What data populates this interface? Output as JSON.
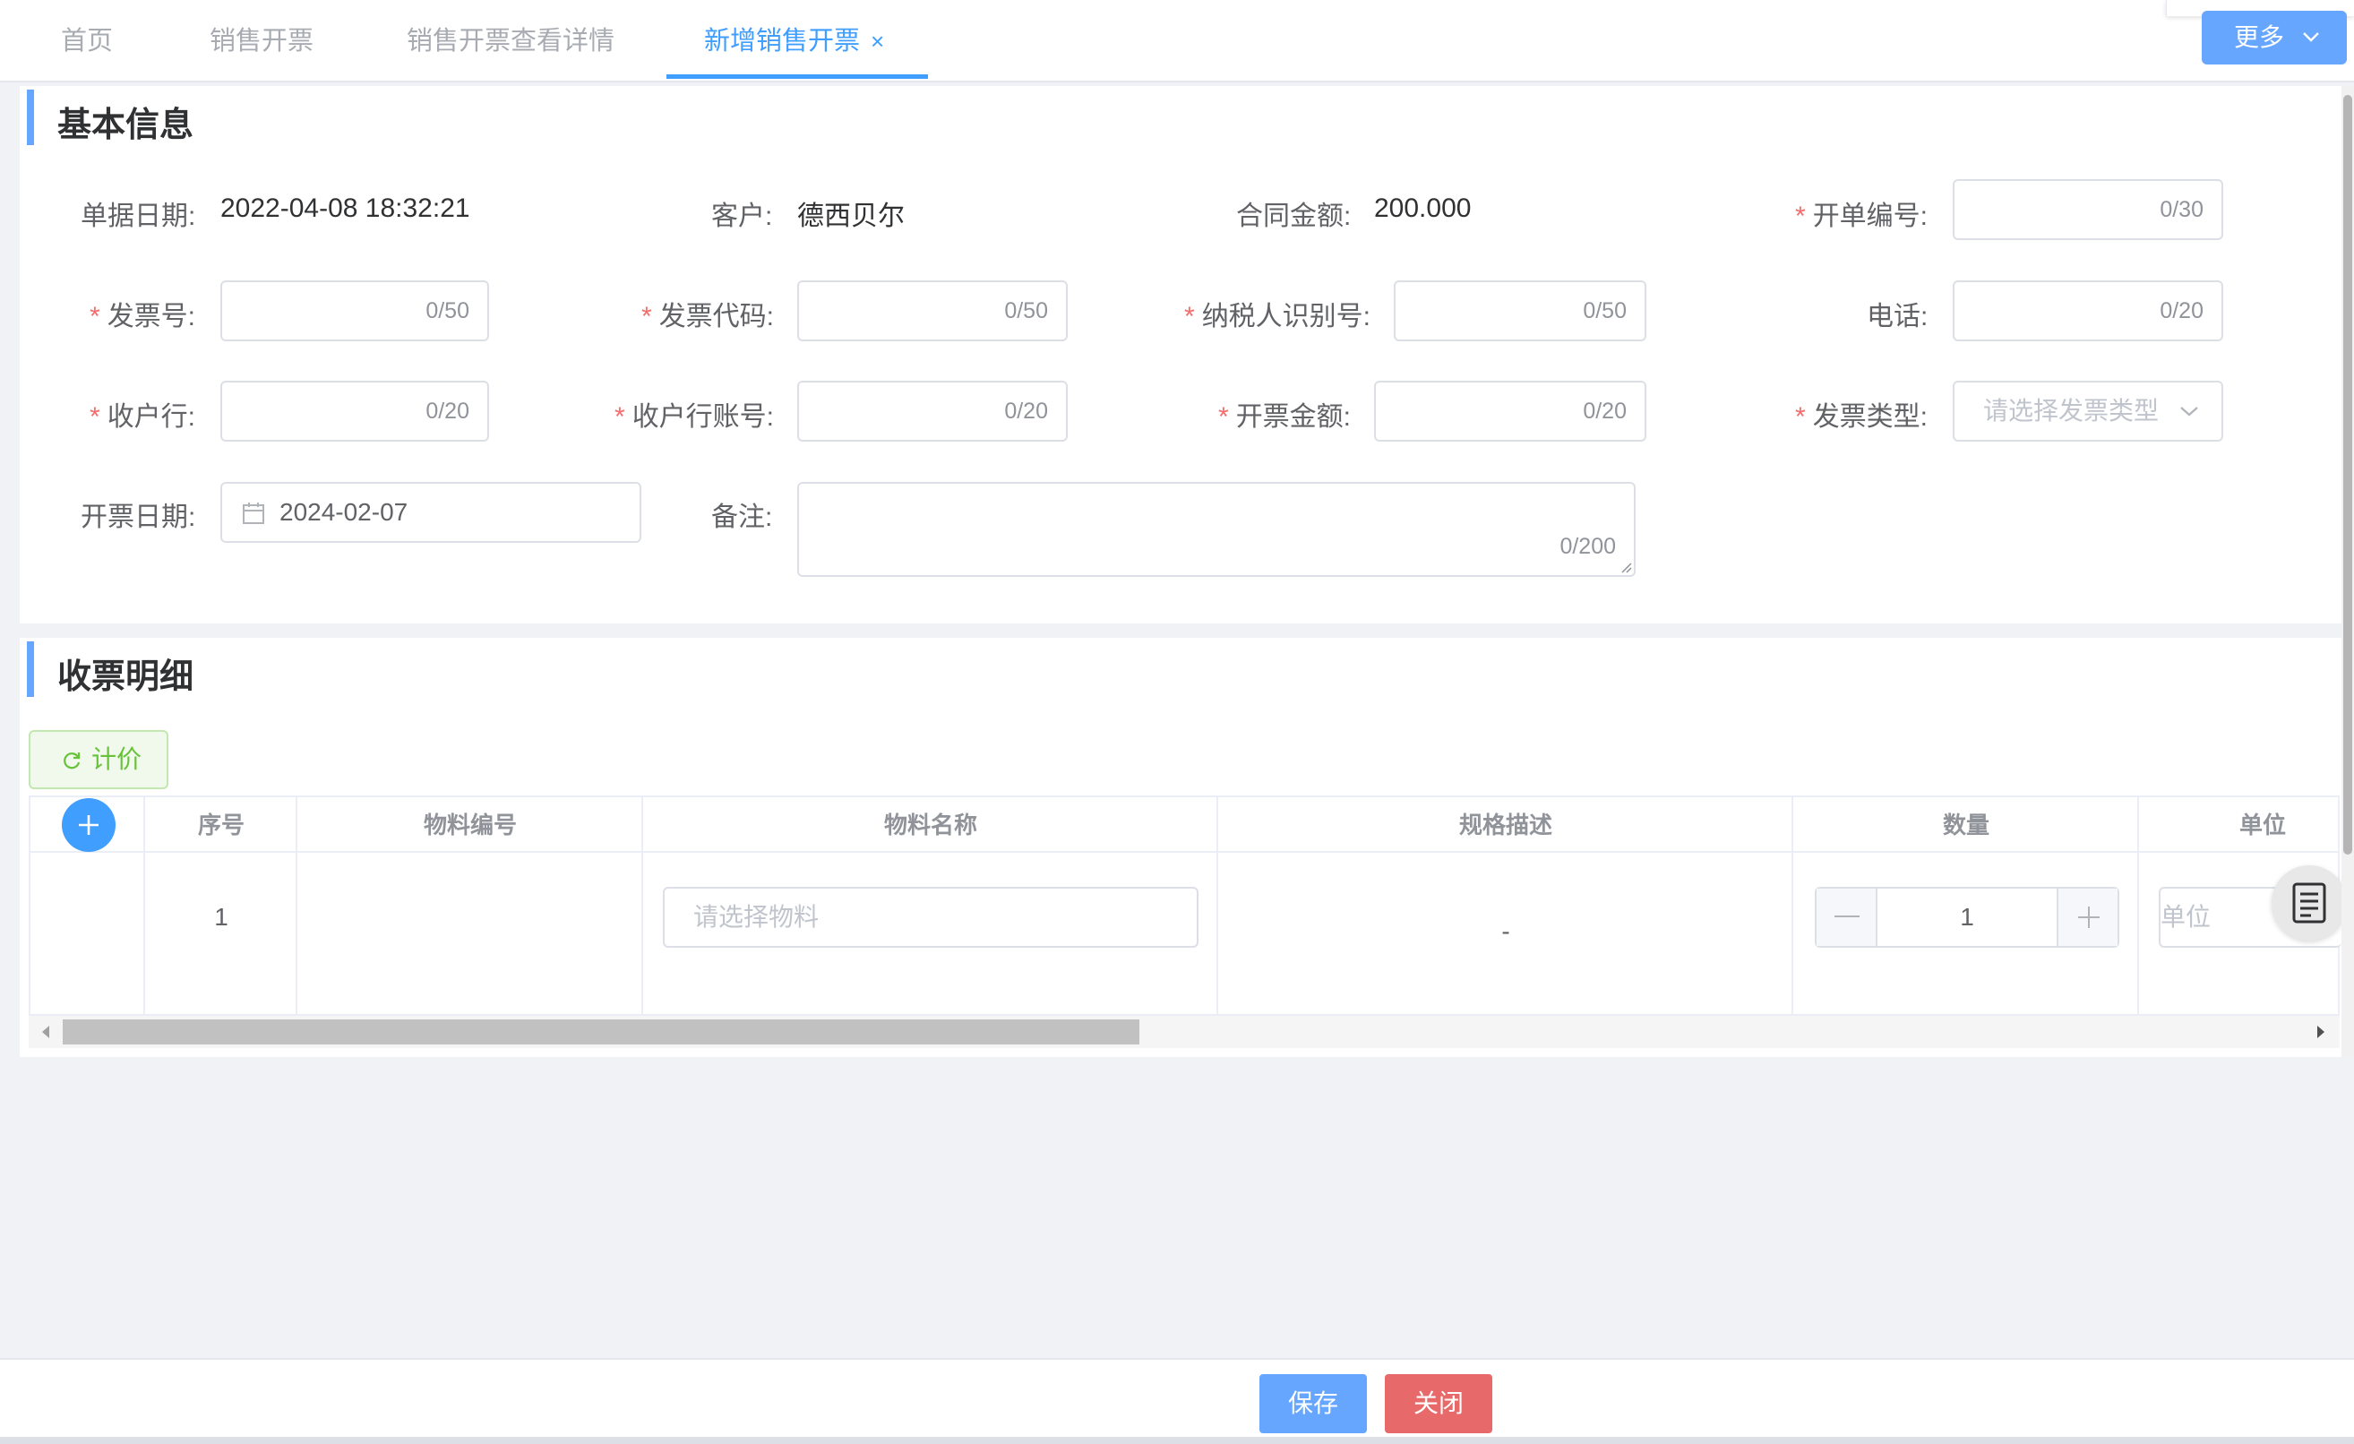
{
  "tabs": [
    {
      "label": "首页"
    },
    {
      "label": "销售开票"
    },
    {
      "label": "销售开票查看详情"
    },
    {
      "label": "新增销售开票"
    }
  ],
  "more_button": "更多",
  "basic": {
    "title": "基本信息",
    "doc_date_label": "单据日期:",
    "doc_date_value": "2022-04-08 18:32:21",
    "customer_label": "客户:",
    "customer_value": "德西贝尔",
    "contract_amount_label": "合同金额:",
    "contract_amount_value": "200.000",
    "bill_no_label": "开单编号:",
    "bill_no_count": "0/30",
    "invoice_no_label": "发票号:",
    "invoice_no_count": "0/50",
    "invoice_code_label": "发票代码:",
    "invoice_code_count": "0/50",
    "taxpayer_id_label": "纳税人识别号:",
    "taxpayer_id_count": "0/50",
    "phone_label": "电话:",
    "phone_count": "0/20",
    "bank_label": "收户行:",
    "bank_count": "0/20",
    "bank_account_label": "收户行账号:",
    "bank_account_count": "0/20",
    "invoice_amount_label": "开票金额:",
    "invoice_amount_count": "0/20",
    "invoice_type_label": "发票类型:",
    "invoice_type_placeholder": "请选择发票类型",
    "invoice_date_label": "开票日期:",
    "invoice_date_value": "2024-02-07",
    "remark_label": "备注:",
    "remark_count": "0/200",
    "required_mark": "*"
  },
  "detail": {
    "title": "收票明细",
    "calc_button": "计价",
    "columns": [
      "序号",
      "物料编号",
      "物料名称",
      "规格描述",
      "数量",
      "单位"
    ],
    "row": {
      "index": "1",
      "material_placeholder": "请选择物料",
      "spec": "-",
      "quantity": "1",
      "unit_placeholder": "单位"
    }
  },
  "footer": {
    "save": "保存",
    "close": "关闭"
  },
  "colors": {
    "primary": "#409eff",
    "danger": "#f56c6c",
    "success": "#67c23a"
  }
}
